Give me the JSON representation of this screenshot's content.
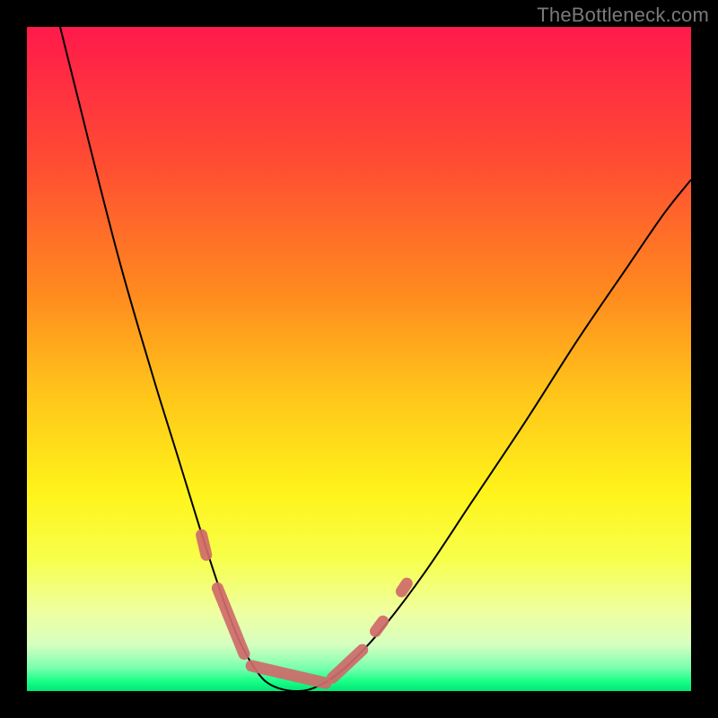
{
  "watermark": "TheBottleneck.com",
  "chart_data": {
    "type": "line",
    "title": "",
    "xlabel": "",
    "ylabel": "",
    "xlim": [
      0,
      1
    ],
    "ylim": [
      0,
      1
    ],
    "grid": false,
    "legend": false,
    "background_gradient": {
      "direction": "vertical",
      "stops": [
        {
          "pos": 0.0,
          "color": "#ff1a4b"
        },
        {
          "pos": 0.2,
          "color": "#ff4b33"
        },
        {
          "pos": 0.4,
          "color": "#ff8a1f"
        },
        {
          "pos": 0.55,
          "color": "#ffc41a"
        },
        {
          "pos": 0.7,
          "color": "#fff31a"
        },
        {
          "pos": 0.8,
          "color": "#f7ff4a"
        },
        {
          "pos": 0.88,
          "color": "#efffa0"
        },
        {
          "pos": 0.93,
          "color": "#d7ffc0"
        },
        {
          "pos": 0.965,
          "color": "#7affae"
        },
        {
          "pos": 0.985,
          "color": "#1aff88"
        },
        {
          "pos": 1.0,
          "color": "#00e676"
        }
      ]
    },
    "series": [
      {
        "name": "bottleneck-curve",
        "color": "#000000",
        "stroke_width": 2,
        "x": [
          0.05,
          0.08,
          0.11,
          0.14,
          0.17,
          0.2,
          0.225,
          0.245,
          0.262,
          0.278,
          0.292,
          0.305,
          0.318,
          0.332,
          0.346,
          0.36,
          0.38,
          0.405,
          0.43,
          0.46,
          0.495,
          0.54,
          0.6,
          0.67,
          0.75,
          0.83,
          0.905,
          0.96,
          1.0
        ],
        "y": [
          1.0,
          0.88,
          0.76,
          0.645,
          0.54,
          0.44,
          0.36,
          0.295,
          0.24,
          0.19,
          0.148,
          0.112,
          0.08,
          0.052,
          0.03,
          0.014,
          0.004,
          0.0,
          0.004,
          0.02,
          0.05,
          0.1,
          0.18,
          0.285,
          0.405,
          0.53,
          0.64,
          0.72,
          0.77
        ]
      }
    ],
    "markers": {
      "name": "highlighted-points",
      "color": "#cf6a6a",
      "stroke_width": 13,
      "stroke_linecap": "round",
      "groups": [
        {
          "x": [
            0.263,
            0.27
          ],
          "y": [
            0.235,
            0.205
          ]
        },
        {
          "x": [
            0.287,
            0.327
          ],
          "y": [
            0.155,
            0.056
          ]
        },
        {
          "x": [
            0.338,
            0.45
          ],
          "y": [
            0.038,
            0.012
          ]
        },
        {
          "x": [
            0.46,
            0.505
          ],
          "y": [
            0.02,
            0.062
          ]
        },
        {
          "x": [
            0.525,
            0.536
          ],
          "y": [
            0.09,
            0.105
          ]
        },
        {
          "x": [
            0.564,
            0.572
          ],
          "y": [
            0.15,
            0.162
          ]
        }
      ]
    }
  }
}
